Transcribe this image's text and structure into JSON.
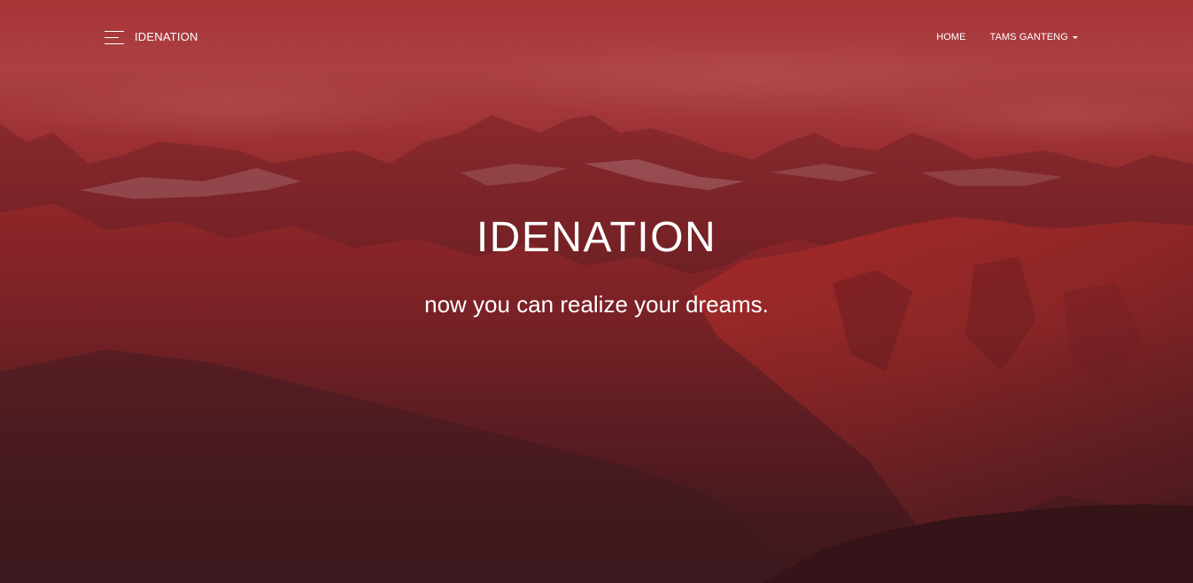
{
  "navbar": {
    "menu_icon": "hamburger-menu-icon",
    "brand": "IDENATION",
    "links": [
      {
        "label": "HOME"
      },
      {
        "label": "TAMS GANTENG",
        "icon": "caret-down-icon"
      }
    ]
  },
  "hero": {
    "title": "IDENATION",
    "subtitle": "now you can realize your dreams.",
    "background": "mountain-landscape-image",
    "overlay_color": "#a8242c"
  }
}
